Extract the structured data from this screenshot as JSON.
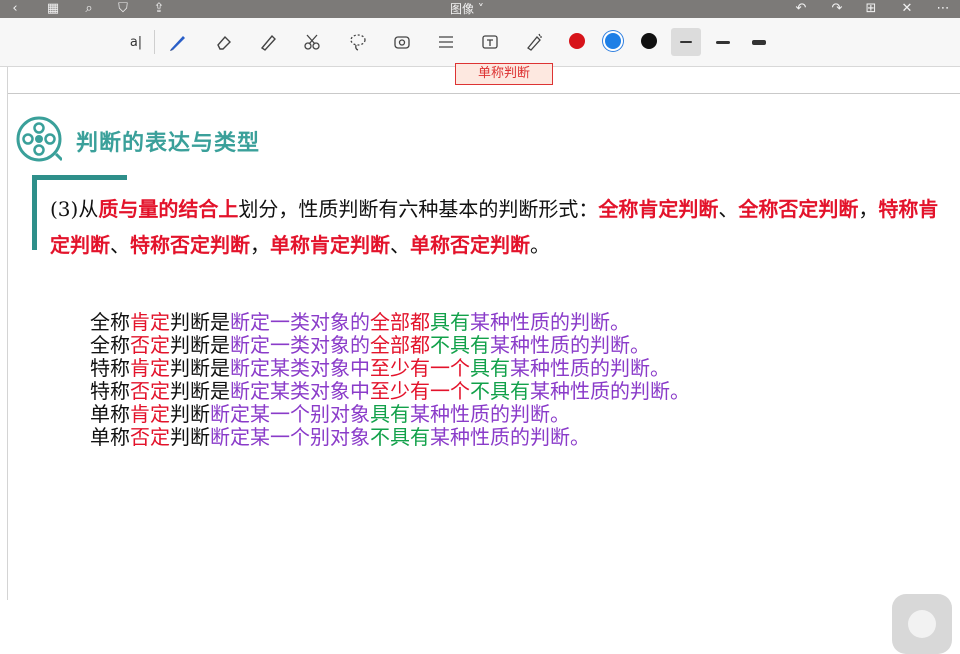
{
  "topbar": {
    "title": "图像 ˅"
  },
  "toolbar": {
    "text_tool": "a|",
    "colors": [
      "#d7141a",
      "#1e7fe6",
      "#111111"
    ],
    "selected_color": "#1e7fe6"
  },
  "document": {
    "prev_box": "单称判断",
    "section_title": "判断的表达与类型",
    "paragraph": [
      {
        "t": "(3)从",
        "s": "n"
      },
      {
        "t": "质与量的结合上",
        "s": "r"
      },
      {
        "t": "划分，性质判断有六种基本的判断形式：",
        "s": "n"
      },
      {
        "t": "全称肯定判断",
        "s": "r"
      },
      {
        "t": "、",
        "s": "n"
      },
      {
        "t": "全称否定判断",
        "s": "r"
      },
      {
        "t": "，",
        "s": "n"
      },
      {
        "t": "特称肯定判断",
        "s": "r"
      },
      {
        "t": "、",
        "s": "n"
      },
      {
        "t": "特称否定判断",
        "s": "r"
      },
      {
        "t": "，",
        "s": "n"
      },
      {
        "t": "单称肯定判断",
        "s": "r"
      },
      {
        "t": "、",
        "s": "n"
      },
      {
        "t": "单称否定判断",
        "s": "r"
      },
      {
        "t": "。",
        "s": "n"
      }
    ],
    "lines": [
      [
        {
          "t": "全称",
          "c": "black"
        },
        {
          "t": "肯定",
          "c": "red"
        },
        {
          "t": "判断是",
          "c": "black"
        },
        {
          "t": "断定一类对象的",
          "c": "purple"
        },
        {
          "t": "全部都",
          "c": "red"
        },
        {
          "t": "具有",
          "c": "green"
        },
        {
          "t": "某种性质",
          "c": "purple"
        },
        {
          "t": "的判断。",
          "c": "purple"
        }
      ],
      [
        {
          "t": "全称",
          "c": "black"
        },
        {
          "t": "否定",
          "c": "red"
        },
        {
          "t": "判断是",
          "c": "black"
        },
        {
          "t": "断定一类对象的",
          "c": "purple"
        },
        {
          "t": "全部都",
          "c": "red"
        },
        {
          "t": "不具有",
          "c": "green"
        },
        {
          "t": "某种性质",
          "c": "purple"
        },
        {
          "t": "的判断。",
          "c": "purple"
        }
      ],
      [
        {
          "t": "特称",
          "c": "black"
        },
        {
          "t": "肯定",
          "c": "red"
        },
        {
          "t": "判断是",
          "c": "black"
        },
        {
          "t": "断定某类对象中",
          "c": "purple"
        },
        {
          "t": "至少有一个",
          "c": "red"
        },
        {
          "t": "具有",
          "c": "green"
        },
        {
          "t": "某种性质",
          "c": "purple"
        },
        {
          "t": "的判断。",
          "c": "purple"
        }
      ],
      [
        {
          "t": "特称",
          "c": "black"
        },
        {
          "t": "否定",
          "c": "red"
        },
        {
          "t": "判断是",
          "c": "black"
        },
        {
          "t": "断定某类对象中",
          "c": "purple"
        },
        {
          "t": "至少有一个",
          "c": "red"
        },
        {
          "t": "不具有",
          "c": "green"
        },
        {
          "t": "某种性质",
          "c": "purple"
        },
        {
          "t": "的判断。",
          "c": "purple"
        }
      ],
      [
        {
          "t": "单称",
          "c": "black"
        },
        {
          "t": "肯定",
          "c": "red"
        },
        {
          "t": "判断",
          "c": "black"
        },
        {
          "t": "断定某一个别对象",
          "c": "purple"
        },
        {
          "t": "具有",
          "c": "green"
        },
        {
          "t": "某种性质",
          "c": "purple"
        },
        {
          "t": "的判断。",
          "c": "purple"
        }
      ],
      [
        {
          "t": "单称",
          "c": "black"
        },
        {
          "t": "否定",
          "c": "red"
        },
        {
          "t": "判断",
          "c": "black"
        },
        {
          "t": "断定某一个别对象",
          "c": "purple"
        },
        {
          "t": "不具有",
          "c": "green"
        },
        {
          "t": "某种性质",
          "c": "purple"
        },
        {
          "t": "的判断。",
          "c": "purple"
        }
      ]
    ]
  }
}
